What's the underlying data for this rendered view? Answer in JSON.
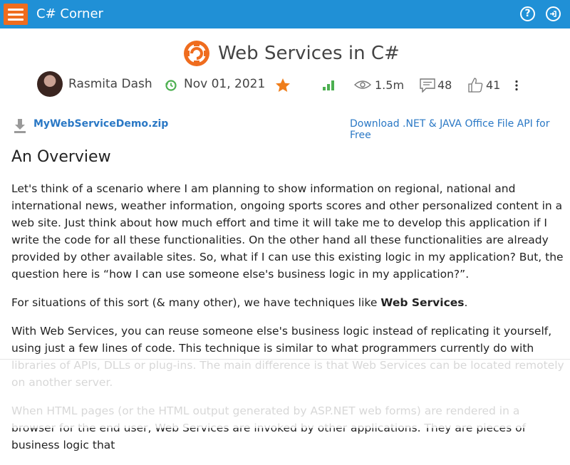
{
  "header": {
    "brand": "C# Corner",
    "help_label": "?",
    "colors": {
      "bar": "#2090d6",
      "menu_button": "#ef6c1e"
    }
  },
  "article": {
    "title": "Web Services in C#",
    "author": "Rasmita Dash",
    "date": "Nov 01, 2021",
    "views": "1.5m",
    "comments": "48",
    "likes": "41",
    "icons": [
      "csharp-logo-icon",
      "refresh-clock-icon",
      "star-icon",
      "level-bars-icon",
      "eye-icon",
      "comment-icon",
      "thumbs-up-icon",
      "more-vertical-icon"
    ]
  },
  "download": {
    "file": "MyWebServiceDemo.zip",
    "promo": "Download .NET & JAVA Office File API for Free"
  },
  "body": {
    "heading": "An Overview",
    "p1": "Let's think of a scenario where I am planning to show information on regional, national and international news, weather information, ongoing sports scores and other personalized content in a web site. Just think about how much effort and time it will take me to develop this application if I write the code for all these functionalities. On the other hand all these functionalities are already provided by other available sites. So, what if I can use this existing logic in my application? But, the question here is “how I can use someone else's business logic in my application?”.",
    "p2_before": "For situations of this sort (& many other), we have techniques like ",
    "p2_bold": "Web Services",
    "p2_after": ".",
    "p3": "With Web Services, you can reuse someone else's business logic instead of replicating it yourself, using just a few lines of code. This technique is similar to what programmers currently do with libraries of APIs, DLLs or plug-ins. The main difference is that Web Services can be located remotely on another server.",
    "p4": "When HTML pages (or the HTML output generated by ASP.NET web forms) are rendered in a browser for the end user, Web Services are invoked by other applications. They are pieces of business logic that"
  }
}
